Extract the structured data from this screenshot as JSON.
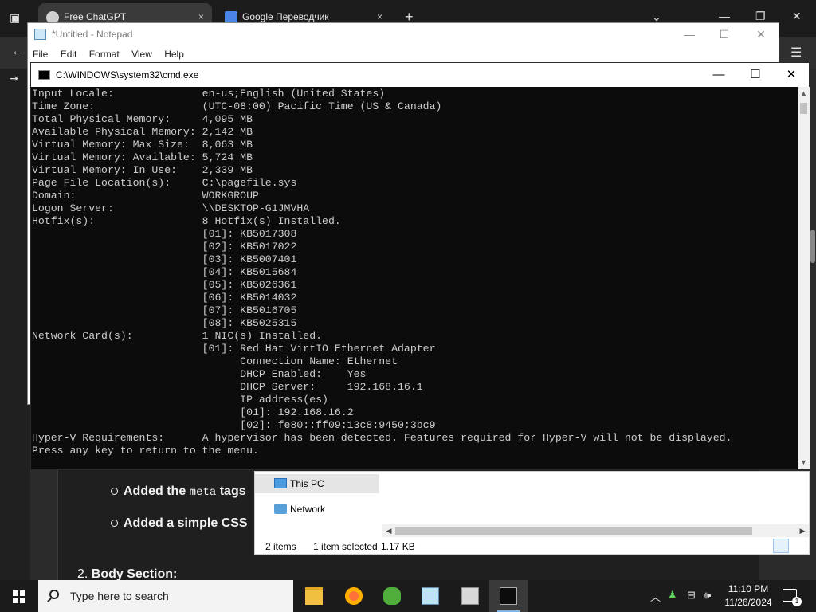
{
  "browser": {
    "tabs": [
      {
        "title": "Free ChatGPT",
        "close": "×"
      },
      {
        "title": "Google Переводчик",
        "close": "×"
      }
    ],
    "new_tab": "+",
    "page": {
      "bullets": [
        {
          "prefix": "Added the ",
          "code": "meta",
          "suffix": " tags"
        },
        {
          "prefix": "Added a simple CSS",
          "code": "",
          "suffix": ""
        }
      ],
      "body_section_num": "2. ",
      "body_section_title": "Body Section:"
    }
  },
  "notepad": {
    "title": "*Untitled - Notepad",
    "menu": [
      "File",
      "Edit",
      "Format",
      "View",
      "Help"
    ]
  },
  "cmd": {
    "title": "C:\\WINDOWS\\system32\\cmd.exe",
    "lines": [
      "Input Locale:              en-us;English (United States)",
      "Time Zone:                 (UTC-08:00) Pacific Time (US & Canada)",
      "Total Physical Memory:     4,095 MB",
      "Available Physical Memory: 2,142 MB",
      "Virtual Memory: Max Size:  8,063 MB",
      "Virtual Memory: Available: 5,724 MB",
      "Virtual Memory: In Use:    2,339 MB",
      "Page File Location(s):     C:\\pagefile.sys",
      "Domain:                    WORKGROUP",
      "Logon Server:              \\\\DESKTOP-G1JMVHA",
      "Hotfix(s):                 8 Hotfix(s) Installed.",
      "                           [01]: KB5017308",
      "                           [02]: KB5017022",
      "                           [03]: KB5007401",
      "                           [04]: KB5015684",
      "                           [05]: KB5026361",
      "                           [06]: KB5014032",
      "                           [07]: KB5016705",
      "                           [08]: KB5025315",
      "Network Card(s):           1 NIC(s) Installed.",
      "                           [01]: Red Hat VirtIO Ethernet Adapter",
      "                                 Connection Name: Ethernet",
      "                                 DHCP Enabled:    Yes",
      "                                 DHCP Server:     192.168.16.1",
      "                                 IP address(es)",
      "                                 [01]: 192.168.16.2",
      "                                 [02]: fe80::ff09:13c8:9450:3bc9",
      "Hyper-V Requirements:      A hypervisor has been detected. Features required for Hyper-V will not be displayed.",
      "Press any key to return to the menu."
    ]
  },
  "explorer": {
    "nav": [
      {
        "label": "This PC",
        "selected": true
      },
      {
        "label": "Network",
        "selected": false
      }
    ],
    "status": {
      "items": "2 items",
      "selected": "1 item selected",
      "size": "1.17 KB"
    }
  },
  "taskbar": {
    "search_placeholder": "Type here to search",
    "apps": [
      "file-explorer",
      "firefox",
      "users-app",
      "notepad",
      "remote-desktop",
      "command-prompt"
    ],
    "time": "11:10 PM",
    "date": "11/26/2024",
    "notification_count": "1"
  },
  "colors": {
    "console_bg": "#0c0c0c",
    "console_fg": "#cccccc",
    "taskbar_bg": "#1b1b1b",
    "accent": "#7fb4e6"
  }
}
